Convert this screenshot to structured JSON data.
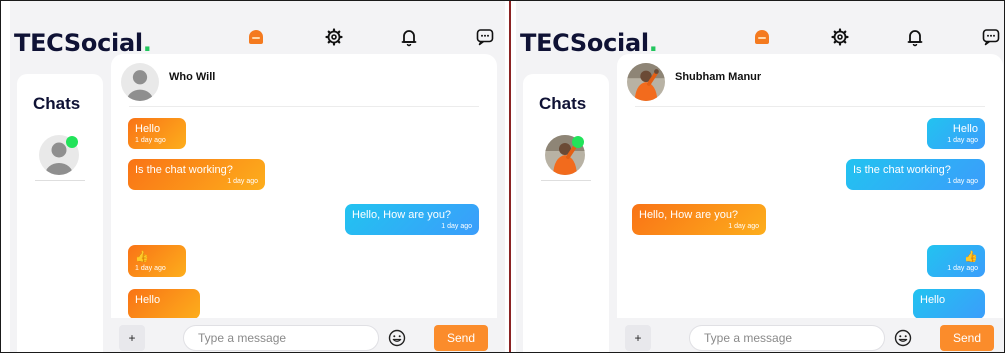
{
  "app": {
    "logo_text": "TECSocial",
    "logo_dot": "."
  },
  "colors": {
    "brand_dark": "#0f1235",
    "received_bubble": "#f97316",
    "sent_bubble": "#22c3f0",
    "online": "#22e35a",
    "send_button": "#fb8c2b",
    "divider": "#8b2323"
  },
  "nav_icons": [
    "home-icon",
    "gear-icon",
    "bell-icon",
    "message-icon"
  ],
  "panels": [
    {
      "sidebar_title": "Chats",
      "contact_name": "Who Will",
      "messages": [
        {
          "direction": "received",
          "text": "Hello",
          "time": "1 day ago"
        },
        {
          "direction": "received",
          "text": "Is the chat working?",
          "time": "1 day ago"
        },
        {
          "direction": "sent",
          "text": "Hello, How are you?",
          "time": "1 day ago"
        },
        {
          "direction": "received",
          "text": "👍",
          "time": "1 day ago"
        },
        {
          "direction": "received",
          "text": "Hello",
          "time": ""
        }
      ],
      "composer": {
        "plus_label": "+",
        "placeholder": "Type a message",
        "send_label": "Send"
      }
    },
    {
      "sidebar_title": "Chats",
      "contact_name": "Shubham Manur",
      "messages": [
        {
          "direction": "sent",
          "text": "Hello",
          "time": "1 day ago"
        },
        {
          "direction": "sent",
          "text": "Is the chat working?",
          "time": "1 day ago"
        },
        {
          "direction": "received",
          "text": "Hello, How are you?",
          "time": "1 day ago"
        },
        {
          "direction": "sent",
          "text": "👍",
          "time": "1 day ago"
        },
        {
          "direction": "sent",
          "text": "Hello",
          "time": ""
        }
      ],
      "composer": {
        "plus_label": "+",
        "placeholder": "Type a message",
        "send_label": "Send"
      }
    }
  ]
}
